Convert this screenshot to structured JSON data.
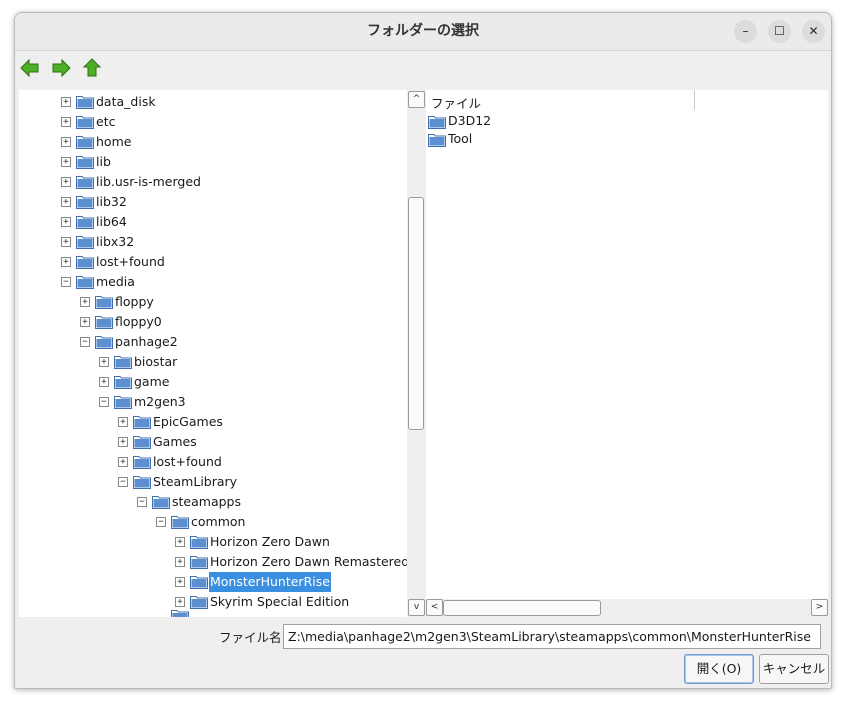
{
  "window": {
    "title": "フォルダーの選択",
    "controls": {
      "minimize": "–",
      "maximize": "☐",
      "close": "✕"
    }
  },
  "toolbar": {
    "back_icon": "green-left-arrow-icon",
    "forward_icon": "green-right-arrow-icon",
    "up_icon": "green-up-arrow-icon"
  },
  "tree": {
    "expander": {
      "collapsed": "+",
      "expanded": "−"
    },
    "selected": "MonsterHunterRise",
    "rows": [
      {
        "label": "data_disk",
        "depth": 0,
        "expanded": false
      },
      {
        "label": "etc",
        "depth": 0,
        "expanded": false
      },
      {
        "label": "home",
        "depth": 0,
        "expanded": false
      },
      {
        "label": "lib",
        "depth": 0,
        "expanded": false
      },
      {
        "label": "lib.usr-is-merged",
        "depth": 0,
        "expanded": false
      },
      {
        "label": "lib32",
        "depth": 0,
        "expanded": false
      },
      {
        "label": "lib64",
        "depth": 0,
        "expanded": false
      },
      {
        "label": "libx32",
        "depth": 0,
        "expanded": false
      },
      {
        "label": "lost+found",
        "depth": 0,
        "expanded": false
      },
      {
        "label": "media",
        "depth": 0,
        "expanded": true
      },
      {
        "label": "floppy",
        "depth": 1,
        "expanded": false
      },
      {
        "label": "floppy0",
        "depth": 1,
        "expanded": false
      },
      {
        "label": "panhage2",
        "depth": 1,
        "expanded": true
      },
      {
        "label": "biostar",
        "depth": 2,
        "expanded": false
      },
      {
        "label": "game",
        "depth": 2,
        "expanded": false
      },
      {
        "label": "m2gen3",
        "depth": 2,
        "expanded": true
      },
      {
        "label": "EpicGames",
        "depth": 3,
        "expanded": false
      },
      {
        "label": "Games",
        "depth": 3,
        "expanded": false
      },
      {
        "label": "lost+found",
        "depth": 3,
        "expanded": false
      },
      {
        "label": "SteamLibrary",
        "depth": 3,
        "expanded": true
      },
      {
        "label": "steamapps",
        "depth": 4,
        "expanded": true
      },
      {
        "label": "common",
        "depth": 5,
        "expanded": true
      },
      {
        "label": "Horizon Zero Dawn",
        "depth": 6,
        "expanded": false
      },
      {
        "label": "Horizon Zero Dawn Remastered",
        "depth": 6,
        "expanded": false
      },
      {
        "label": "MonsterHunterRise",
        "depth": 6,
        "expanded": false
      },
      {
        "label": "Skyrim Special Edition",
        "depth": 6,
        "expanded": false
      }
    ]
  },
  "scrollbar": {
    "up": "^",
    "down": "v",
    "left": "<",
    "right": ">"
  },
  "file_list": {
    "column_header": "ファイル",
    "items": [
      "D3D12",
      "Tool"
    ]
  },
  "filename": {
    "label": "ファイル名:",
    "value": "Z:\\media\\panhage2\\m2gen3\\SteamLibrary\\steamapps\\common\\MonsterHunterRise"
  },
  "buttons": {
    "open": "開く(O)",
    "cancel": "キャンセル"
  },
  "colors": {
    "selection": "#3b8fe0",
    "folder": "#5b8fd0",
    "arrow": "#4caf26"
  }
}
